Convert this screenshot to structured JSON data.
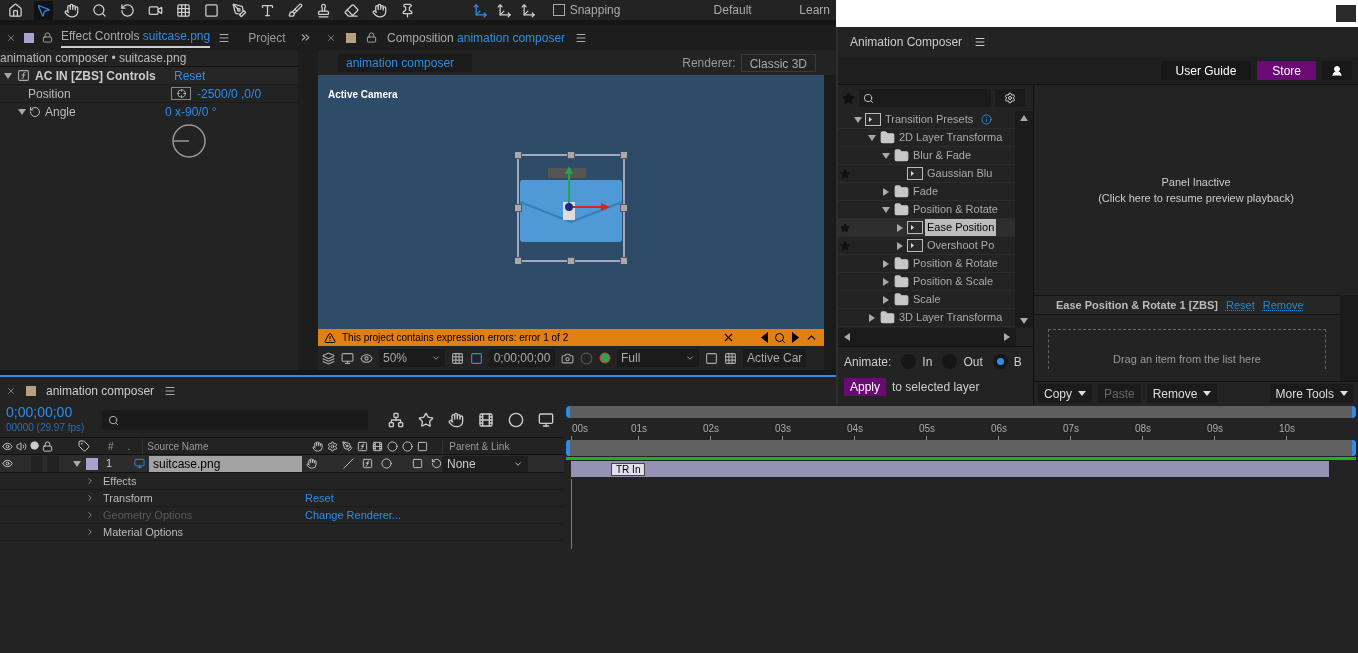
{
  "toolbar": {
    "snapping": {
      "label": "Snapping",
      "checked": false
    },
    "workspaces": [
      "Default",
      "Learn"
    ]
  },
  "effect_controls": {
    "tab": {
      "label": "Effect Controls",
      "layer": "suitcase.png"
    },
    "other_tab": "Project",
    "breadcrumb": "animation composer • suitcase.png",
    "effect": {
      "name": "AC IN [ZBS] Controls",
      "reset": "Reset",
      "expanded": true
    },
    "properties": [
      {
        "kind": "point",
        "name": "Position",
        "value": "-2500/0 ,0/0"
      },
      {
        "kind": "angle",
        "name": "Angle",
        "value": "0 x-90/0 °",
        "expanded": true
      }
    ]
  },
  "composition": {
    "tab": {
      "label": "Composition",
      "name": "animation composer"
    },
    "comp_tab": "animation composer",
    "renderer_label": "Renderer:",
    "renderer": "Classic 3D",
    "camera_label": "Active Camera",
    "error": "This project contains expression errors: error 1 of 2",
    "zoom": "50%",
    "timecode": "0;00;00;00",
    "resolution": "Full",
    "view": "Active Car"
  },
  "animation_composer": {
    "title": "Animation Composer",
    "buttons": [
      {
        "label": "User Guide",
        "kind": "plain"
      },
      {
        "label": "Store",
        "kind": "accent"
      }
    ],
    "tree": [
      {
        "kind": "preset",
        "label": "Transition Presets",
        "starred": false,
        "selected": false,
        "expanded": true,
        "children": [
          {
            "kind": "folder",
            "label": "2D Layer Transforma",
            "starred": false,
            "selected": false,
            "expanded": true,
            "children": [
              {
                "kind": "folder",
                "label": "Blur & Fade",
                "starred": false,
                "selected": false,
                "expanded": true,
                "children": [
                  {
                    "kind": "preset",
                    "label": "Gaussian Blu",
                    "starred": true,
                    "selected": false
                  }
                ]
              },
              {
                "kind": "folder",
                "label": "Fade",
                "starred": false,
                "selected": false,
                "expanded": false
              },
              {
                "kind": "folder",
                "label": "Position & Rotate",
                "starred": false,
                "selected": false,
                "expanded": true,
                "children": [
                  {
                    "kind": "preset",
                    "label": "Ease Position",
                    "starred": true,
                    "selected": true,
                    "expanded": false
                  },
                  {
                    "kind": "preset",
                    "label": "Overshoot Po",
                    "starred": true,
                    "selected": false,
                    "expanded": false
                  }
                ]
              },
              {
                "kind": "folder",
                "label": "Position & Rotate",
                "starred": false,
                "selected": false,
                "expanded": false
              },
              {
                "kind": "folder",
                "label": "Position & Scale",
                "starred": false,
                "selected": false,
                "expanded": false
              },
              {
                "kind": "folder",
                "label": "Scale",
                "starred": false,
                "selected": false,
                "expanded": false
              }
            ]
          },
          {
            "kind": "folder",
            "label": "3D Layer Transforma",
            "starred": false,
            "selected": false,
            "expanded": false
          }
        ]
      }
    ],
    "preview": {
      "title": "Panel Inactive",
      "hint": "(Click here to resume preview playback)"
    },
    "detail": {
      "title": "Ease Position & Rotate 1 [ZBS]",
      "links": [
        "Reset",
        "Remove"
      ],
      "drop_hint": "Drag an item from the list here"
    },
    "animate_label": "Animate:",
    "animate_options": [
      {
        "label": "In",
        "selected": false
      },
      {
        "label": "Out",
        "selected": false
      },
      {
        "label": "B",
        "selected": true
      }
    ],
    "apply": {
      "button": "Apply",
      "label": "to selected layer"
    },
    "actions": [
      {
        "label": "Copy",
        "menu": true,
        "disabled": false
      },
      {
        "label": "Paste",
        "menu": false,
        "disabled": true
      },
      {
        "label": "Remove",
        "menu": true,
        "disabled": false
      },
      {
        "label": "More Tools",
        "menu": true,
        "disabled": false
      }
    ]
  },
  "timeline": {
    "tab": "animation composer",
    "timecode": "0;00;00;00",
    "frames": "00000 (29.97 fps)",
    "columns": {
      "number": "#",
      "dot": ".",
      "source": "Source Name",
      "parent": "Parent & Link"
    },
    "layer": {
      "number": "1",
      "name": "suitcase.png",
      "parent": "None",
      "visible": true,
      "solo": false,
      "locked": false,
      "expanded": true
    },
    "groups": [
      {
        "label": "Effects",
        "disabled": false
      },
      {
        "label": "Transform",
        "disabled": false,
        "action": "Reset"
      },
      {
        "label": "Geometry Options",
        "disabled": true,
        "action": "Change Renderer..."
      },
      {
        "label": "Material Options",
        "disabled": false
      }
    ],
    "ticks": [
      "00s",
      "01s",
      "02s",
      "03s",
      "04s",
      "05s",
      "06s",
      "07s",
      "08s",
      "09s",
      "10s"
    ],
    "marker": "TR In"
  }
}
